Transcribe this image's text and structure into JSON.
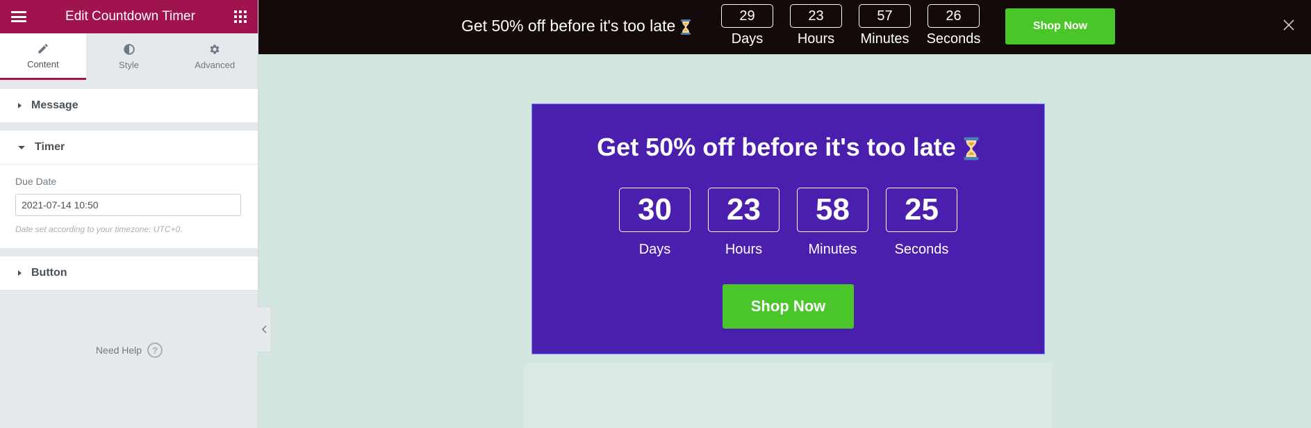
{
  "sidebar": {
    "title": "Edit Countdown Timer",
    "tabs": [
      {
        "label": "Content",
        "icon": "pencil-icon"
      },
      {
        "label": "Style",
        "icon": "half-circle-icon"
      },
      {
        "label": "Advanced",
        "icon": "gear-icon"
      }
    ],
    "sections": {
      "message": "Message",
      "timer": "Timer",
      "button": "Button"
    },
    "due_date": {
      "label": "Due Date",
      "value": "2021-07-14 10:50",
      "hint": "Date set according to your timezone: UTC+0."
    },
    "need_help": "Need Help",
    "help_glyph": "?"
  },
  "topbar": {
    "message": "Get 50% off before it's too late",
    "timer": [
      {
        "value": "29",
        "label": "Days"
      },
      {
        "value": "23",
        "label": "Hours"
      },
      {
        "value": "57",
        "label": "Minutes"
      },
      {
        "value": "26",
        "label": "Seconds"
      }
    ],
    "button": "Shop Now",
    "background": "#140a09"
  },
  "widget": {
    "title": "Get 50% off before it's too late",
    "timer": [
      {
        "value": "30",
        "label": "Days"
      },
      {
        "value": "23",
        "label": "Hours"
      },
      {
        "value": "58",
        "label": "Minutes"
      },
      {
        "value": "25",
        "label": "Seconds"
      }
    ],
    "button": "Shop Now",
    "background": "#4b1fad",
    "button_color": "#4ac62a"
  },
  "colors": {
    "brand": "#a0134e",
    "canvas": "#d3e5df"
  }
}
